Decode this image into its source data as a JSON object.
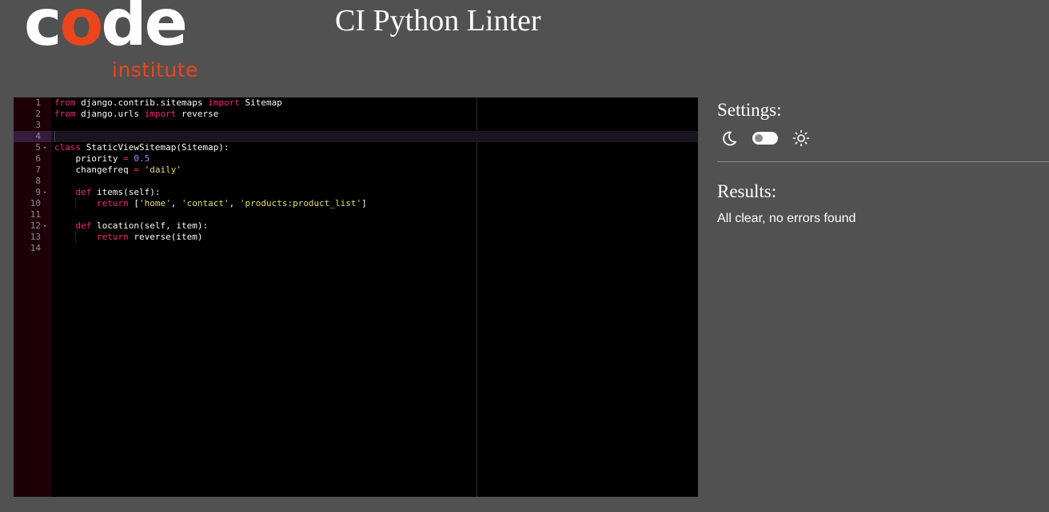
{
  "header": {
    "logo_main": "code",
    "logo_sub": "institute",
    "title": "CI Python Linter"
  },
  "editor": {
    "lines": [
      {
        "num": "1",
        "fold": false,
        "active": false,
        "segments": [
          {
            "t": "from",
            "c": "kw"
          },
          {
            "t": " django.contrib.sitemaps ",
            "c": ""
          },
          {
            "t": "import",
            "c": "kw"
          },
          {
            "t": " Sitemap",
            "c": ""
          }
        ]
      },
      {
        "num": "2",
        "fold": false,
        "active": false,
        "segments": [
          {
            "t": "from",
            "c": "kw"
          },
          {
            "t": " django.urls ",
            "c": ""
          },
          {
            "t": "import",
            "c": "kw"
          },
          {
            "t": " reverse",
            "c": ""
          }
        ]
      },
      {
        "num": "3",
        "fold": false,
        "active": false,
        "segments": []
      },
      {
        "num": "4",
        "fold": false,
        "active": true,
        "segments": []
      },
      {
        "num": "5",
        "fold": true,
        "active": false,
        "segments": [
          {
            "t": "class",
            "c": "kw"
          },
          {
            "t": " StaticViewSitemap(Sitemap):",
            "c": ""
          }
        ]
      },
      {
        "num": "6",
        "fold": false,
        "active": false,
        "segments": [
          {
            "t": "    priority ",
            "c": ""
          },
          {
            "t": "=",
            "c": "op"
          },
          {
            "t": " ",
            "c": ""
          },
          {
            "t": "0.5",
            "c": "num"
          }
        ]
      },
      {
        "num": "7",
        "fold": false,
        "active": false,
        "segments": [
          {
            "t": "    changefreq ",
            "c": ""
          },
          {
            "t": "=",
            "c": "op"
          },
          {
            "t": " ",
            "c": ""
          },
          {
            "t": "'daily'",
            "c": "str"
          }
        ]
      },
      {
        "num": "8",
        "fold": false,
        "active": false,
        "segments": []
      },
      {
        "num": "9",
        "fold": true,
        "active": false,
        "segments": [
          {
            "t": "    ",
            "c": ""
          },
          {
            "t": "def",
            "c": "kw"
          },
          {
            "t": " items(self):",
            "c": ""
          }
        ]
      },
      {
        "num": "10",
        "fold": false,
        "active": false,
        "guide": true,
        "segments": [
          {
            "t": "        ",
            "c": ""
          },
          {
            "t": "return",
            "c": "kw"
          },
          {
            "t": " [",
            "c": ""
          },
          {
            "t": "'home'",
            "c": "str"
          },
          {
            "t": ", ",
            "c": ""
          },
          {
            "t": "'contact'",
            "c": "str"
          },
          {
            "t": ", ",
            "c": ""
          },
          {
            "t": "'products:product_list'",
            "c": "str"
          },
          {
            "t": "]",
            "c": ""
          }
        ]
      },
      {
        "num": "11",
        "fold": false,
        "active": false,
        "segments": []
      },
      {
        "num": "12",
        "fold": true,
        "active": false,
        "segments": [
          {
            "t": "    ",
            "c": ""
          },
          {
            "t": "def",
            "c": "kw"
          },
          {
            "t": " location(self, item):",
            "c": ""
          }
        ]
      },
      {
        "num": "13",
        "fold": false,
        "active": false,
        "guide": true,
        "segments": [
          {
            "t": "        ",
            "c": ""
          },
          {
            "t": "return",
            "c": "kw"
          },
          {
            "t": " reverse(item)",
            "c": ""
          }
        ]
      },
      {
        "num": "14",
        "fold": false,
        "active": false,
        "segments": []
      }
    ]
  },
  "settings": {
    "title": "Settings:",
    "dark_icon": "moon-icon",
    "light_icon": "sun-icon",
    "theme_toggle": "off"
  },
  "results": {
    "title": "Results:",
    "message": "All clear, no errors found"
  },
  "colors": {
    "page_bg": "#515151",
    "editor_bg": "#000000",
    "brand_orange": "#e8461c",
    "keyword": "#f92672",
    "string": "#e6db74",
    "number": "#ae81ff"
  }
}
